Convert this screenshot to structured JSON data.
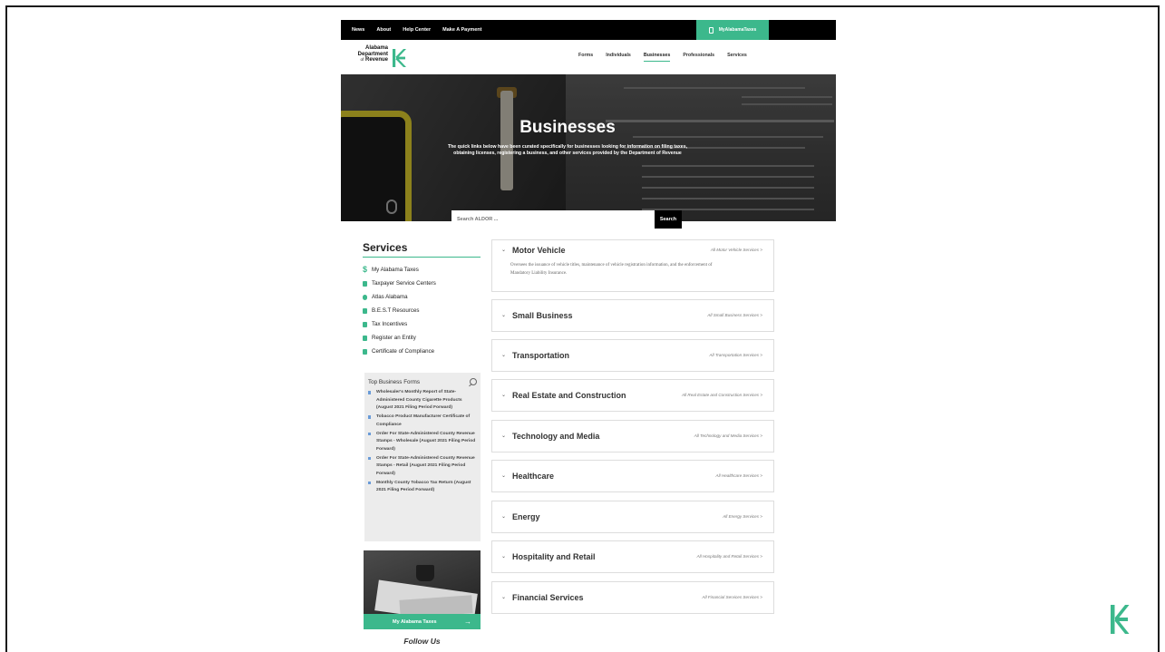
{
  "topbar": {
    "links": [
      "News",
      "About",
      "Help Center",
      "Make A Payment"
    ],
    "my_taxes": "MyAlabamaTaxes"
  },
  "logo": {
    "line1": "Alabama",
    "line2": "Department",
    "line3_prefix": "of",
    "line3": "Revenue"
  },
  "nav": {
    "items": [
      "Forms",
      "Individuals",
      "Businesses",
      "Professionals",
      "Services"
    ],
    "active": "Businesses"
  },
  "hero": {
    "title": "Businesses",
    "description": "The quick links below have been curated specifically for businesses looking for information on filing taxes, obtaining licenses, registering a business, and other services provided by the Department of Revenue"
  },
  "search": {
    "placeholder": "Search ALDOR ...",
    "button": "Search"
  },
  "services": {
    "heading": "Services",
    "items": [
      {
        "label": "My Alabama Taxes",
        "icon": "dollar-icon"
      },
      {
        "label": "Taxpayer Service Centers",
        "icon": "building-icon"
      },
      {
        "label": "Atlas Alabama",
        "icon": "globe-icon"
      },
      {
        "label": "B.E.S.T Resources",
        "icon": "document-icon"
      },
      {
        "label": "Tax Incentives",
        "icon": "file-icon"
      },
      {
        "label": "Register an Entity",
        "icon": "document-icon"
      },
      {
        "label": "Certificate of Compliance",
        "icon": "document-icon"
      }
    ]
  },
  "top_forms": {
    "heading": "Top Business Forms",
    "items": [
      "Wholesaler's Monthly Report of State-Administered County Cigarette Products (August 2021 Filing Period Forward)",
      "Tobacco Product Manufacturer Certificate of Compliance",
      "Order For State-Administered County Revenue Stamps - Wholesale (August 2021 Filing Period Forward)",
      "Order For State-Administered County Revenue Stamps - Retail (August 2021 Filing Period Forward)",
      "Monthly County Tobacco Tax Return (August 2021 Filing Period Forward)"
    ]
  },
  "promo": {
    "label": "My Alabama Taxes",
    "arrow": "→"
  },
  "follow_us": "Follow Us",
  "categories": [
    {
      "title": "Motor Vehicle",
      "link": "All Motor Vehicle Services >",
      "description": "Oversees the issuance of vehicle titles, maintenance of vehicle registration information, and the enforcement of Mandatory Liability Insurance.",
      "expanded": true
    },
    {
      "title": "Small Business",
      "link": "All Small Business Services >"
    },
    {
      "title": "Transportation",
      "link": "All Transportation Services >"
    },
    {
      "title": "Real Estate and Construction",
      "link": "All Real Estate and Construction Services >"
    },
    {
      "title": "Technology and Media",
      "link": "All Technology and Media Services >"
    },
    {
      "title": "Healthcare",
      "link": "All Healthcare Services >"
    },
    {
      "title": "Energy",
      "link": "All Energy Services >"
    },
    {
      "title": "Hospitality and Retail",
      "link": "All Hospitality and Retail Services >"
    },
    {
      "title": "Financial Services",
      "link": "All Financial Services Services >"
    }
  ],
  "colors": {
    "accent": "#3cb88c",
    "topbar": "#000000",
    "panel": "#ececec"
  }
}
